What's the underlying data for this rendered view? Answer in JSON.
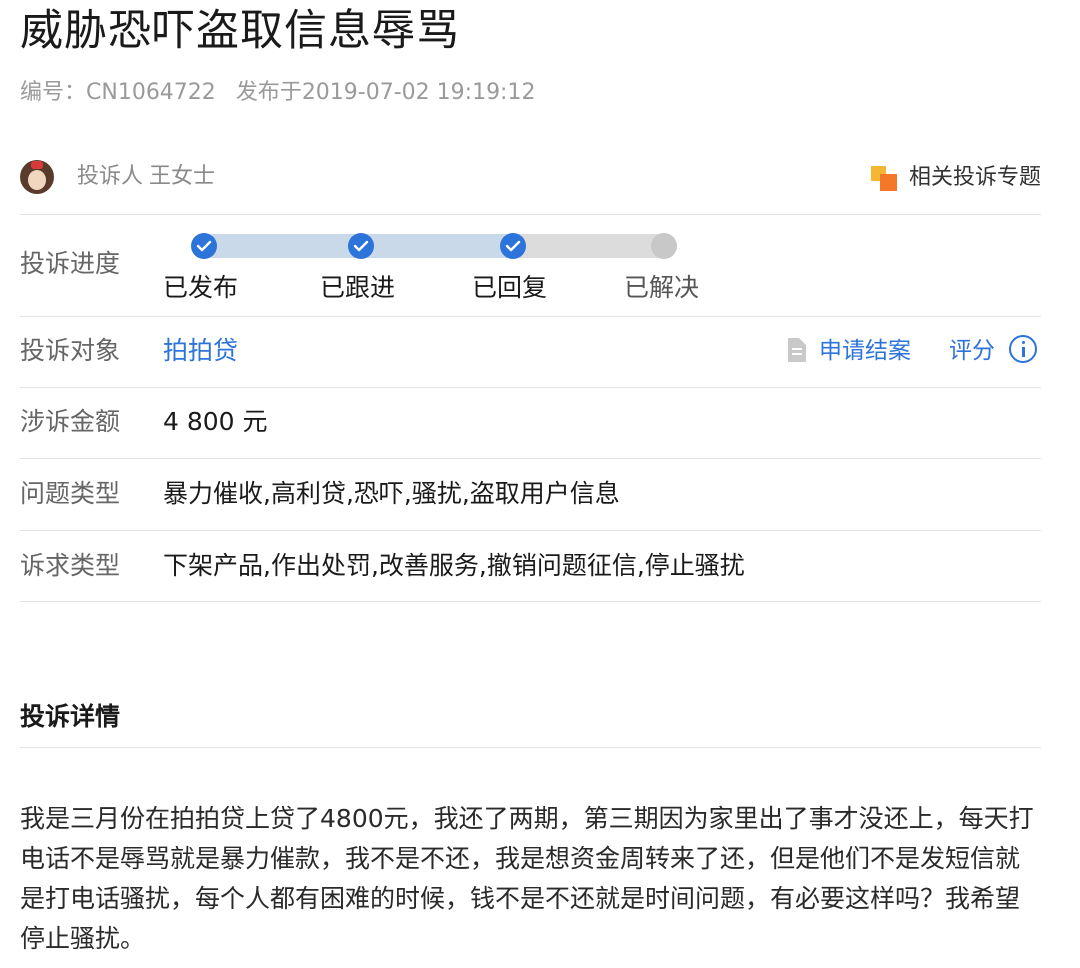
{
  "header": {
    "title": "威胁恐吓盗取信息辱骂",
    "id_text": "编号：CN1064722",
    "published_text": "发布于2019-07-02 19:19:12"
  },
  "complainant": {
    "label": "投诉人",
    "name": "王女士",
    "related_topic": "相关投诉专题"
  },
  "progress": {
    "label": "投诉进度",
    "completed_fraction": 0.67,
    "steps": [
      {
        "label": "已发布",
        "done": true
      },
      {
        "label": "已跟进",
        "done": true
      },
      {
        "label": "已回复",
        "done": true
      },
      {
        "label": "已解决",
        "done": false
      }
    ]
  },
  "target": {
    "label": "投诉对象",
    "value": "拍拍贷",
    "apply_close": "申请结案",
    "rate": "评分"
  },
  "amount": {
    "label": "涉诉金额",
    "value": "4 800 元"
  },
  "issue_type": {
    "label": "问题类型",
    "value": "暴力催收,高利贷,恐吓,骚扰,盗取用户信息"
  },
  "demand_type": {
    "label": "诉求类型",
    "value": "下架产品,作出处罚,改善服务,撤销问题征信,停止骚扰"
  },
  "details": {
    "heading": "投诉详情",
    "text": "我是三月份在拍拍贷上贷了4800元，我还了两期，第三期因为家里出了事才没还上，每天打电话不是辱骂就是暴力催款，我不是不还，我是想资金周转来了还，但是他们不是发短信就是打电话骚扰，每个人都有困难的时候，钱不是不还就是时间问题，有必要这样吗？我希望停止骚扰。"
  },
  "colors": {
    "accent": "#2d74da",
    "track_done": "#c9d9ea",
    "track_pending": "#dcdcdc"
  }
}
